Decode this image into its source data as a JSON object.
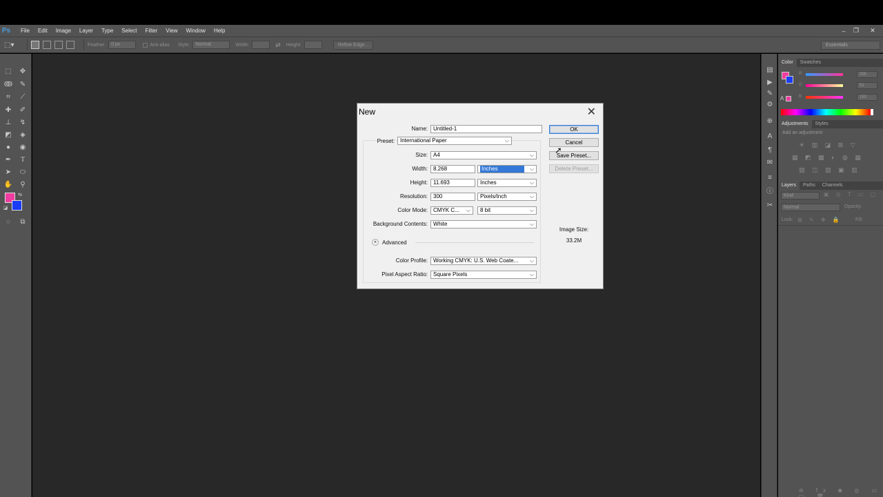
{
  "app": {
    "logo": "Ps",
    "menu": [
      "File",
      "Edit",
      "Image",
      "Layer",
      "Type",
      "Select",
      "Filter",
      "View",
      "Window",
      "Help"
    ],
    "window_controls": [
      "–",
      "❐",
      "✕"
    ]
  },
  "options_bar": {
    "feather_label": "Feather:",
    "feather_value": "0 px",
    "antialias_label": "Anti-alias",
    "style_label": "Style:",
    "style_value": "Normal",
    "width_label": "Width:",
    "height_label": "Height:",
    "refine_edge": "Refine Edge...",
    "workspace": "Essentials"
  },
  "panels": {
    "color_tabs": [
      "Color",
      "Swatches"
    ],
    "color_values": {
      "r": "255",
      "g": "51",
      "b": "153"
    },
    "color_channel_labels": {
      "r": "R",
      "g": "G",
      "b": "B"
    },
    "adjustments_tabs": [
      "Adjustments",
      "Styles"
    ],
    "add_adjustment": "Add an adjustment",
    "layers_tabs": [
      "Layers",
      "Paths",
      "Channels"
    ],
    "kind": "Kind",
    "blend_mode": "Normal",
    "opacity_label": "Opacity:",
    "lock_label": "Lock:",
    "fill_label": "Fill:"
  },
  "colors": {
    "foreground": "#f03ca0",
    "background": "#1a3cf5",
    "accent": "#3378d7"
  },
  "dialog": {
    "title": "New",
    "close": "✕",
    "name_label": "Name:",
    "name_value": "Untitled-1",
    "preset_label": "Preset:",
    "preset_value": "International Paper",
    "size_label": "Size:",
    "size_value": "A4",
    "width_label": "Width:",
    "width_value": "8.268",
    "width_unit": "Inches",
    "height_label": "Height:",
    "height_value": "11.693",
    "height_unit": "Inches",
    "resolution_label": "Resolution:",
    "resolution_value": "300",
    "resolution_unit": "Pixels/Inch",
    "color_mode_label": "Color Mode:",
    "color_mode_value": "CMYK C...",
    "bit_depth": "8 bit",
    "background_label": "Background Contents:",
    "background_value": "White",
    "advanced_label": "Advanced",
    "advanced_icon": "«",
    "profile_label": "Color Profile:",
    "profile_value": "Working CMYK:  U.S. Web Coate...",
    "pixel_aspect_label": "Pixel Aspect Ratio:",
    "pixel_aspect_value": "Square Pixels",
    "ok": "OK",
    "cancel": "Cancel",
    "save_preset": "Save Preset...",
    "delete_preset": "Delete Preset...",
    "image_size_label": "Image Size:",
    "image_size_value": "33.2M"
  }
}
